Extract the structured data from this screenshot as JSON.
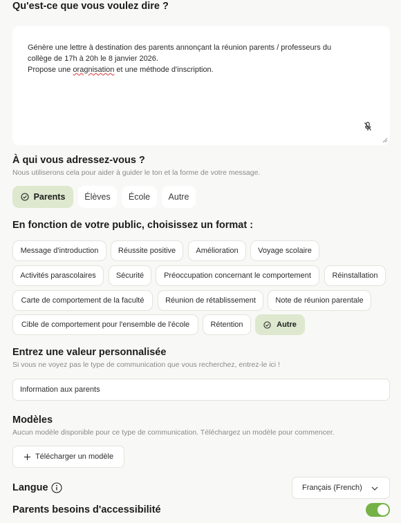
{
  "prompt": {
    "title": "Qu'est-ce que vous voulez dire ?",
    "text_line1": "Génère une lettre à destination des parents annonçant la réunion parents / professeurs du",
    "text_line2": "collège de 17h à 20h le 8 janvier 2026.",
    "text_line3_before": "Propose une ",
    "text_line3_misspelled": "oragnisation",
    "text_line3_after": " et une méthode d'inscription."
  },
  "audience": {
    "title": "À qui vous adressez-vous ?",
    "helper": "Nous utiliserons cela pour aider à guider le ton et la forme de votre message.",
    "options": [
      "Parents",
      "Élèves",
      "École",
      "Autre"
    ],
    "selected": "Parents"
  },
  "format": {
    "title": "En fonction de votre public, choisissez un format :",
    "options": [
      "Message d'introduction",
      "Réussite positive",
      "Amélioration",
      "Voyage scolaire",
      "Activités parascolaires",
      "Sécurité",
      "Préoccupation concernant le comportement",
      "Réinstallation",
      "Carte de comportement de la faculté",
      "Réunion de rétablissement",
      "Note de réunion parentale",
      "Cible de comportement pour l'ensemble de l'école",
      "Rétention",
      "Autre"
    ],
    "selected": "Autre"
  },
  "custom": {
    "title": "Entrez une valeur personnalisée",
    "helper": "Si vous ne voyez pas le type de communication que vous recherchez, entrez-le ici !",
    "value": "Information aux parents"
  },
  "models": {
    "title": "Modèles",
    "helper": "Aucun modèle disponible pour ce type de communication. Téléchargez un modèle pour commencer.",
    "upload_label": "Télécharger un modèle"
  },
  "language": {
    "label": "Langue",
    "value": "Français (French)"
  },
  "accessibility": {
    "label": "Parents besoins d'accessibilité",
    "enabled": true
  },
  "colors": {
    "selected_bg": "#dde8cf",
    "toggle_on": "#74b247",
    "page_bg": "#f8f8f6"
  }
}
